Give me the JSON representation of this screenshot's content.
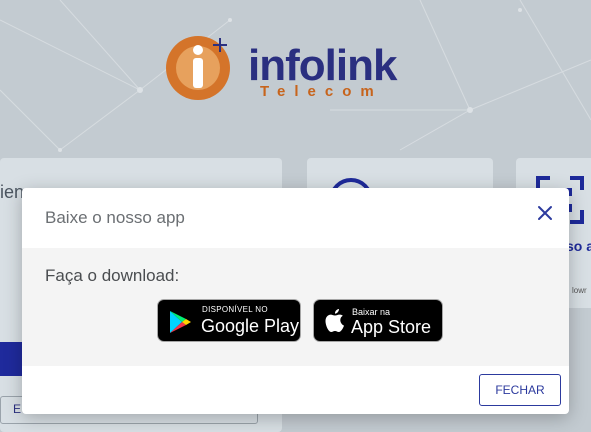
{
  "background": {
    "logo": {
      "name": "infolink",
      "tagline": "Telecom"
    },
    "left_card": {
      "partial_text": "ien",
      "outline_button_text": "E"
    },
    "right_card": {
      "partial_bold": "so a",
      "partial_small": "lowr"
    }
  },
  "modal": {
    "title": "Baixe o nosso app",
    "close_icon": "close-icon",
    "subtitle": "Faça o download:",
    "google_play": {
      "small_text": "DISPONÍVEL NO",
      "big_text": "Google Play"
    },
    "app_store": {
      "small_text": "Baixar na",
      "big_text": "App Store"
    },
    "close_button_label": "FECHAR"
  },
  "colors": {
    "accent": "#2c3a9e",
    "logo_orange": "#c7641c",
    "logo_navy": "#2a2f80"
  }
}
